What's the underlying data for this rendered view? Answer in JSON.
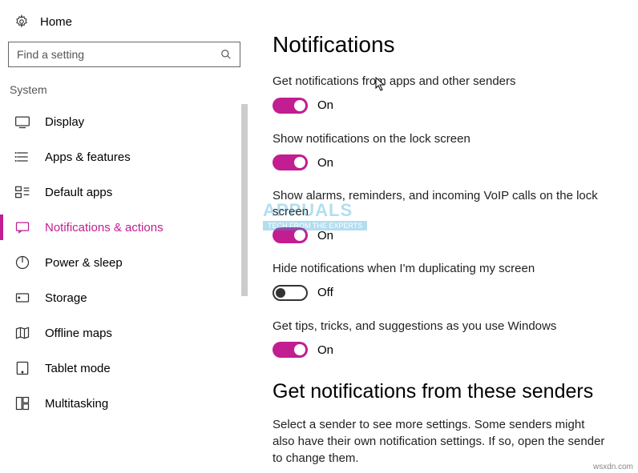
{
  "home": {
    "label": "Home"
  },
  "search": {
    "placeholder": "Find a setting"
  },
  "category": "System",
  "nav": [
    {
      "label": "Display"
    },
    {
      "label": "Apps & features"
    },
    {
      "label": "Default apps"
    },
    {
      "label": "Notifications & actions"
    },
    {
      "label": "Power & sleep"
    },
    {
      "label": "Storage"
    },
    {
      "label": "Offline maps"
    },
    {
      "label": "Tablet mode"
    },
    {
      "label": "Multitasking"
    }
  ],
  "main": {
    "heading": "Notifications",
    "settings": [
      {
        "label": "Get notifications from apps and other senders",
        "state": "On"
      },
      {
        "label": "Show notifications on the lock screen",
        "state": "On"
      },
      {
        "label": "Show alarms, reminders, and incoming VoIP calls on the lock screen",
        "state": "On"
      },
      {
        "label": "Hide notifications when I'm duplicating my screen",
        "state": "Off"
      },
      {
        "label": "Get tips, tricks, and suggestions as you use Windows",
        "state": "On"
      }
    ],
    "subheading": "Get notifications from these senders",
    "description": "Select a sender to see more settings. Some senders might also have their own notification settings. If so, open the sender to change them."
  },
  "watermark": {
    "brand": "APPUALS",
    "sub": "TECH FROM THE EXPERTS"
  },
  "attribution": "wsxdn.com"
}
